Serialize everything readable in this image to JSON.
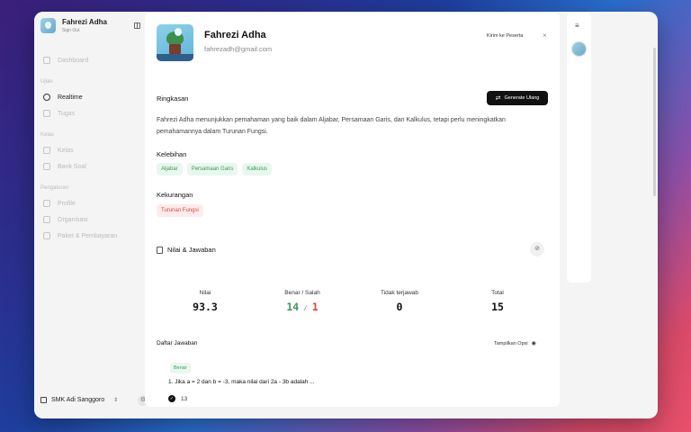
{
  "sidebar": {
    "user_name": "Fahrezi Adha",
    "user_sub": "Sign Out",
    "items": [
      {
        "label": "Dashboard"
      },
      {
        "label": "Realtime"
      },
      {
        "label": "Tugas"
      },
      {
        "label": "Kelas"
      },
      {
        "label": "Bank Soal"
      },
      {
        "label": "Profile"
      },
      {
        "label": "Organisasi"
      },
      {
        "label": "Paket & Pembayaran"
      }
    ],
    "sections": [
      "Ujian",
      "Kelas",
      "Pengaturan"
    ],
    "org_name": "SMK Adi Sanggoro"
  },
  "profile": {
    "name": "Fahrezi Adha",
    "email": "fahrezadh@gmail.com",
    "send_label": "Kirim ke Peserta",
    "close": "×"
  },
  "ringkasan": {
    "title": "Ringkasan",
    "generate_label": "Generate Ulang",
    "text": "Fahrezi Adha menunjukkan pemahaman yang baik dalam Aljabar, Persamaan Garis, dan Kalkulus, tetapi perlu meningkatkan pemahamannya dalam Turunan Fungsi."
  },
  "kelebihan": {
    "title": "Kelebihan",
    "tags": [
      "Aljabar",
      "Persamaan Garis",
      "Kalkulus"
    ]
  },
  "kekurangan": {
    "title": "Kekurangan",
    "tags": [
      "Turunan Fungsi"
    ]
  },
  "nilai": {
    "title": "Nilai & Jawaban",
    "stats": {
      "nilai_label": "Nilai",
      "nilai_value": "93.3",
      "bs_label": "Benar / Salah",
      "benar": "14",
      "salah": "1",
      "tidak_label": "Tidak terjawab",
      "tidak_value": "0",
      "total_label": "Total",
      "total_value": "15"
    }
  },
  "jawaban": {
    "title": "Daftar Jawaban",
    "opsi_label": "Tampilkan Opsi",
    "items": [
      {
        "status": "Benar",
        "question": "1. Jika a = 2 dan b = -3, maka nilai dari 2a - 3b adalah ...",
        "answer": "13"
      }
    ]
  },
  "colors": {
    "accent": "#111111",
    "good": "#3a9a5a",
    "bad": "#d24a3c"
  }
}
